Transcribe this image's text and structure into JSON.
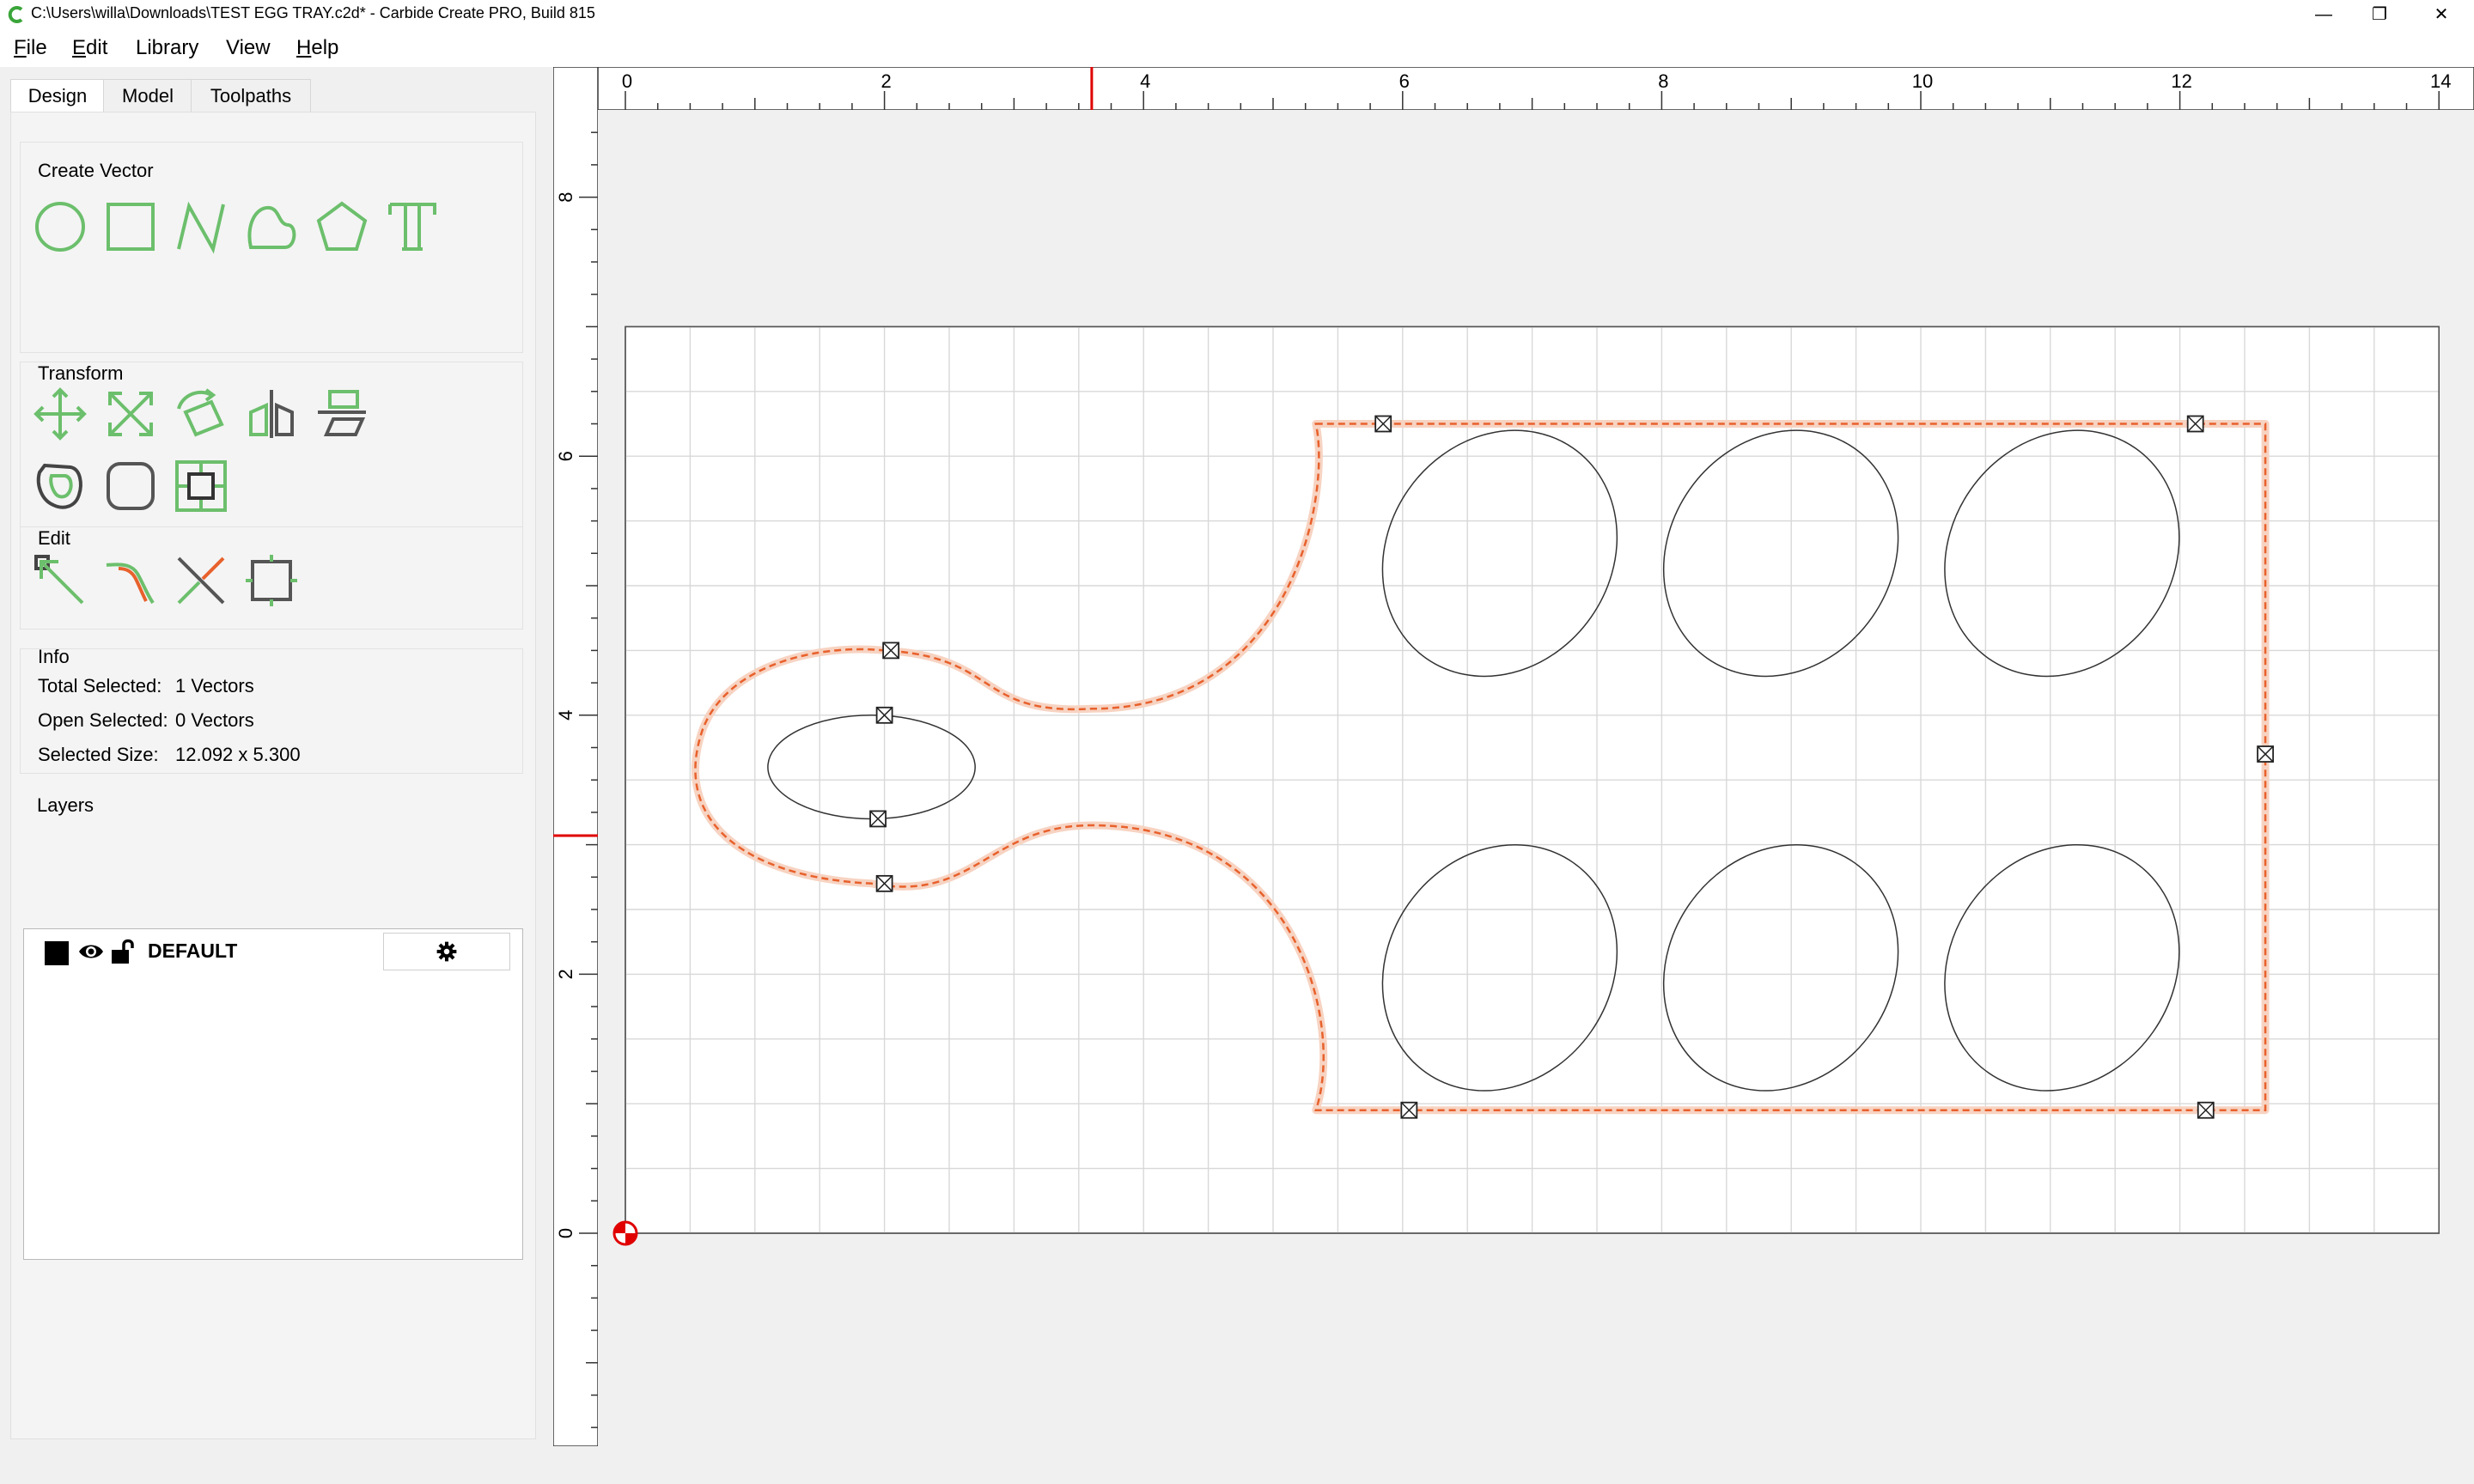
{
  "window": {
    "title": "C:\\Users\\willa\\Downloads\\TEST EGG TRAY.c2d* - Carbide Create PRO, Build 815",
    "minimize_glyph": "—",
    "maximize_glyph": "❐",
    "close_glyph": "✕"
  },
  "menu": {
    "items": [
      {
        "mnemonic": "F",
        "rest": "ile"
      },
      {
        "mnemonic": "E",
        "rest": "dit"
      },
      {
        "mnemonic": "",
        "rest": "Library"
      },
      {
        "mnemonic": "",
        "rest": "View"
      },
      {
        "mnemonic": "H",
        "rest": "elp"
      }
    ]
  },
  "tabs": [
    "Design",
    "Model",
    "Toolpaths"
  ],
  "active_tab": "Design",
  "groups": {
    "create_vector": {
      "title": "Create Vector",
      "tools": [
        "circle-icon",
        "rectangle-icon",
        "polyline-icon",
        "curve-icon",
        "polygon-icon",
        "text-icon"
      ]
    },
    "transform": {
      "title": "Transform",
      "tools": [
        "move-icon",
        "scale-icon",
        "rotate-icon",
        "mirror-icon",
        "align-icon",
        "offset-icon",
        "fillet-icon",
        "boolean-icon",
        "circular-array-icon",
        "rectangular-array-icon"
      ]
    },
    "edit": {
      "title": "Edit",
      "tools": [
        "node-edit-icon",
        "join-icon",
        "trim-icon",
        "box-select-icon"
      ]
    }
  },
  "info": {
    "title": "Info",
    "rows": [
      {
        "label": "Total Selected:",
        "value": "1 Vectors"
      },
      {
        "label": "Open Selected:",
        "value": "0 Vectors"
      },
      {
        "label": "Selected Size:",
        "value": "12.092 x 5.300"
      }
    ]
  },
  "layers": {
    "title": "Layers",
    "items": [
      {
        "name": "DEFAULT",
        "color": "#000000",
        "visible": true,
        "locked": false
      }
    ]
  },
  "colors": {
    "accent_green": "#6cbf6c",
    "selection_orange": "#e8612c",
    "ruler_marker": "#e00000",
    "grid": "#d8d8d8"
  },
  "ruler": {
    "x_labels": [
      "0",
      "2",
      "4",
      "6",
      "8",
      "10",
      "12",
      "14"
    ],
    "y_labels": [
      "0",
      "2",
      "4",
      "6",
      "8"
    ],
    "x_cursor": 3.6,
    "y_cursor": 3.07
  },
  "stock": {
    "width": 14,
    "height": 7
  },
  "selected_shape": {
    "label": "egg tray outline",
    "tail_ellipse": {
      "cx": 1.9,
      "cy": 3.6,
      "rx": 0.8,
      "ry": 0.4
    }
  },
  "egg_holes": [
    {
      "cx": 6.75,
      "cy": 5.25
    },
    {
      "cx": 8.92,
      "cy": 5.25
    },
    {
      "cx": 11.09,
      "cy": 5.25
    },
    {
      "cx": 6.75,
      "cy": 2.05
    },
    {
      "cx": 8.92,
      "cy": 2.05
    },
    {
      "cx": 11.09,
      "cy": 2.05
    }
  ],
  "egg_size": {
    "rx": 0.86,
    "ry": 0.99,
    "rotation_deg": 35
  }
}
